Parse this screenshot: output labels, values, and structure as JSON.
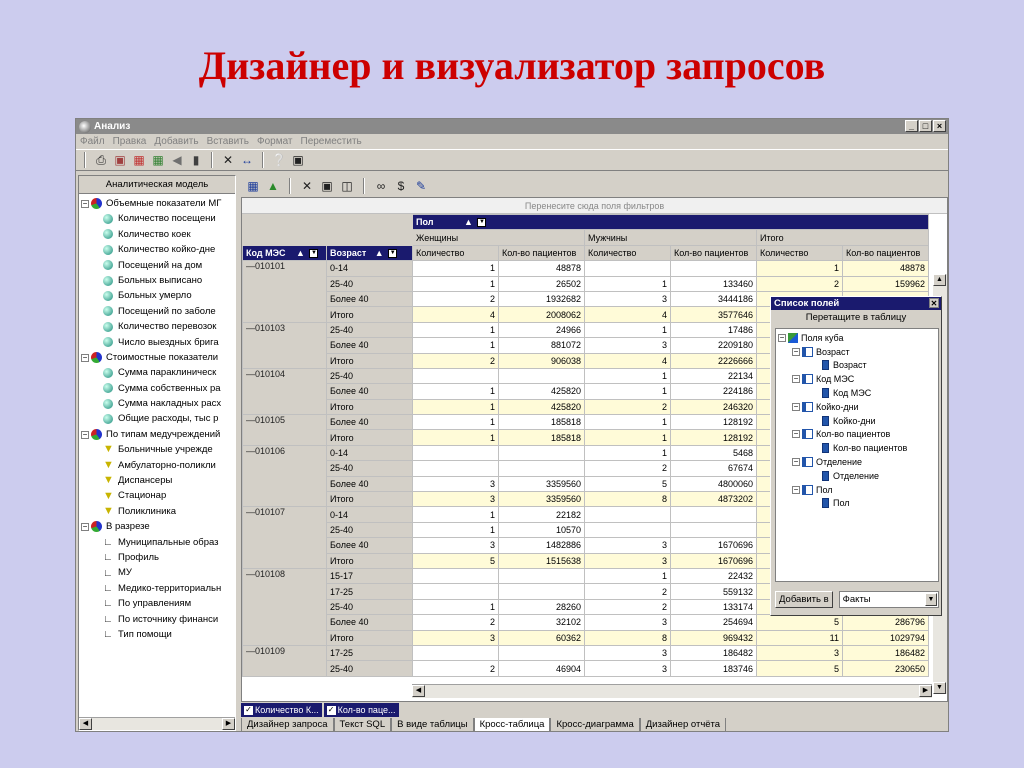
{
  "slide": {
    "title": "Дизайнер и визуализатор запросов"
  },
  "window": {
    "title": "Анализ",
    "btn_min": "_",
    "btn_max": "□",
    "btn_close": "×"
  },
  "menu": [
    "Файл",
    "Правка",
    "Добавить",
    "Вставить",
    "Формат",
    "Переместить"
  ],
  "left_panel": {
    "header": "Аналитическая модель",
    "groups": [
      {
        "label": "Объемные показатели МГ",
        "icon": "pie-icon",
        "items": [
          "Количество посещени",
          "Количество коек",
          "Количество койко-дне",
          "Посещений на дом",
          "Больных выписано",
          "Больных умерло",
          "Посещений по заболе",
          "Количество перевозок",
          "Число выездных брига"
        ],
        "item_icon": "ball-icon"
      },
      {
        "label": "Стоимостные показатели",
        "icon": "pie-icon",
        "items": [
          "Сумма параклиническ",
          "Сумма собственных ра",
          "Сумма накладных расх",
          "Общие расходы, тыс р"
        ],
        "item_icon": "ball-icon"
      },
      {
        "label": "По типам медучреждений",
        "icon": "pie-icon",
        "items": [
          "Больничные учрежде",
          "Амбулаторно-поликли",
          "Диспансеры",
          "Стационар",
          "Поликлиника"
        ],
        "item_icon": "filter-icon"
      },
      {
        "label": "В разрезе",
        "icon": "pie-icon",
        "items": [
          "Муниципальные образ",
          "Профиль",
          "МУ",
          "Медико-территориальн",
          "По управлениям",
          "По источнику финанси",
          "Тип помощи"
        ],
        "item_icon": "axis-icon"
      }
    ]
  },
  "pivot": {
    "filter_zone": "Перенесите сюда поля фильтров",
    "col_field": "Пол",
    "row_fields": [
      "Код МЭС",
      "Возраст"
    ],
    "groups": [
      "Женщины",
      "Мужчины",
      "Итого"
    ],
    "measures": [
      "Количество",
      "Кол-во пациентов"
    ],
    "rows": [
      [
        "010101",
        "0-14",
        "1",
        "48878",
        "",
        "",
        "1",
        "48878",
        false
      ],
      [
        "",
        "25-40",
        "1",
        "26502",
        "1",
        "133460",
        "2",
        "159962",
        false
      ],
      [
        "",
        "Более 40",
        "2",
        "1932682",
        "3",
        "3444186",
        "",
        "",
        false
      ],
      [
        "",
        "Итого",
        "4",
        "2008062",
        "4",
        "3577646",
        "",
        "",
        true
      ],
      [
        "010103",
        "25-40",
        "1",
        "24966",
        "1",
        "17486",
        "",
        "",
        false
      ],
      [
        "",
        "Более 40",
        "1",
        "881072",
        "3",
        "2209180",
        "",
        "",
        false
      ],
      [
        "",
        "Итого",
        "2",
        "906038",
        "4",
        "2226666",
        "",
        "",
        true
      ],
      [
        "010104",
        "25-40",
        "",
        "",
        "1",
        "22134",
        "",
        "",
        false
      ],
      [
        "",
        "Более 40",
        "1",
        "425820",
        "1",
        "224186",
        "",
        "",
        false
      ],
      [
        "",
        "Итого",
        "1",
        "425820",
        "2",
        "246320",
        "",
        "",
        true
      ],
      [
        "010105",
        "Более 40",
        "1",
        "185818",
        "1",
        "128192",
        "",
        "",
        false
      ],
      [
        "",
        "Итого",
        "1",
        "185818",
        "1",
        "128192",
        "",
        "",
        true
      ],
      [
        "010106",
        "0-14",
        "",
        "",
        "1",
        "5468",
        "",
        "",
        false
      ],
      [
        "",
        "25-40",
        "",
        "",
        "2",
        "67674",
        "",
        "",
        false
      ],
      [
        "",
        "Более 40",
        "3",
        "3359560",
        "5",
        "4800060",
        "",
        "",
        false
      ],
      [
        "",
        "Итого",
        "3",
        "3359560",
        "8",
        "4873202",
        "",
        "",
        true
      ],
      [
        "010107",
        "0-14",
        "1",
        "22182",
        "",
        "",
        "",
        "",
        false
      ],
      [
        "",
        "25-40",
        "1",
        "10570",
        "",
        "",
        "",
        "",
        false
      ],
      [
        "",
        "Более 40",
        "3",
        "1482886",
        "3",
        "1670696",
        "",
        "",
        false
      ],
      [
        "",
        "Итого",
        "5",
        "1515638",
        "3",
        "1670696",
        "",
        "",
        true
      ],
      [
        "010108",
        "15-17",
        "",
        "",
        "1",
        "22432",
        "",
        "",
        false
      ],
      [
        "",
        "17-25",
        "",
        "",
        "2",
        "559132",
        "",
        "",
        false
      ],
      [
        "",
        "25-40",
        "1",
        "28260",
        "2",
        "133174",
        "",
        "",
        false
      ],
      [
        "",
        "Более 40",
        "2",
        "32102",
        "3",
        "254694",
        "5",
        "286796",
        false
      ],
      [
        "",
        "Итого",
        "3",
        "60362",
        "8",
        "969432",
        "11",
        "1029794",
        true
      ],
      [
        "010109",
        "17-25",
        "",
        "",
        "3",
        "186482",
        "3",
        "186482",
        false
      ],
      [
        "",
        "25-40",
        "2",
        "46904",
        "3",
        "183746",
        "5",
        "230650",
        false
      ]
    ],
    "checks": [
      "Количество К...",
      "Кол-во паце..."
    ],
    "tabs": [
      "Дизайнер запроса",
      "Текст SQL",
      "В виде таблицы",
      "Кросс-таблица",
      "Кросс-диаграмма",
      "Дизайнер отчёта"
    ],
    "active_tab": "Кросс-таблица"
  },
  "field_list": {
    "title": "Список полей",
    "subtitle": "Перетащите в таблицу",
    "root": "Поля куба",
    "dims": [
      {
        "label": "Возраст",
        "field": "Возраст"
      },
      {
        "label": "Код МЭС",
        "field": "Код МЭС"
      },
      {
        "label": "Койко-дни",
        "field": "Койко-дни"
      },
      {
        "label": "Кол-во пациентов",
        "field": "Кол-во пациентов"
      },
      {
        "label": "Отделение",
        "field": "Отделение"
      },
      {
        "label": "Пол",
        "field": "Пол"
      }
    ],
    "add_button": "Добавить в",
    "combo_value": "Факты"
  },
  "colors": {
    "title": "#cc0000",
    "background": "#ccccee",
    "header_navy": "#1a1a6e",
    "total_row": "#fffbd8"
  }
}
